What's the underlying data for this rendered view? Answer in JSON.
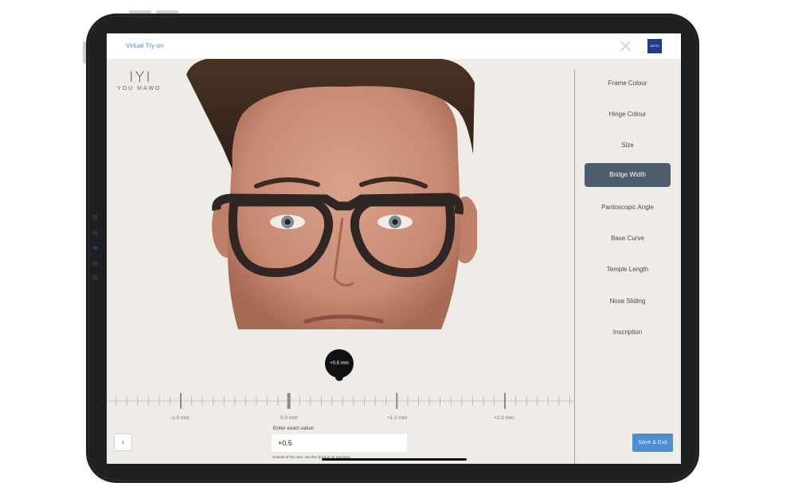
{
  "app": {
    "title": "Virtual Try-on",
    "logo_text": "ZEISS"
  },
  "brand": {
    "mark": "IYI",
    "name": "YOU MAWO"
  },
  "adjustment": {
    "bubble_value": "+0.5 mm",
    "ruler_labels": [
      "-1.0 mm",
      "0.0 mm",
      "+1.0 mm",
      "+2.0 mm"
    ],
    "ruler_range_mm": [
      -1.0,
      2.0
    ],
    "current_mm": 0.5,
    "enter_label": "Enter exact value:",
    "input_value": "+0.5",
    "note": "*Instead of the ruler, use the function for precision"
  },
  "menu": {
    "items": [
      {
        "label": "Frame Colour",
        "active": false
      },
      {
        "label": "Hinge Colour",
        "active": false
      },
      {
        "label": "Size",
        "active": false
      },
      {
        "label": "Bridge Width",
        "active": true
      },
      {
        "label": "Pantoscopic Angle",
        "active": false
      },
      {
        "label": "Base Curve",
        "active": false
      },
      {
        "label": "Temple Length",
        "active": false
      },
      {
        "label": "Nose Sliding",
        "active": false
      },
      {
        "label": "Inscription",
        "active": false
      }
    ]
  },
  "actions": {
    "save_label": "Save & Exit",
    "back_glyph": "‹"
  },
  "colors": {
    "accent": "#4d8fd1",
    "active_menu": "#4e5d6b",
    "background": "#efebe7",
    "zeiss_blue": "#1c3c8c"
  }
}
